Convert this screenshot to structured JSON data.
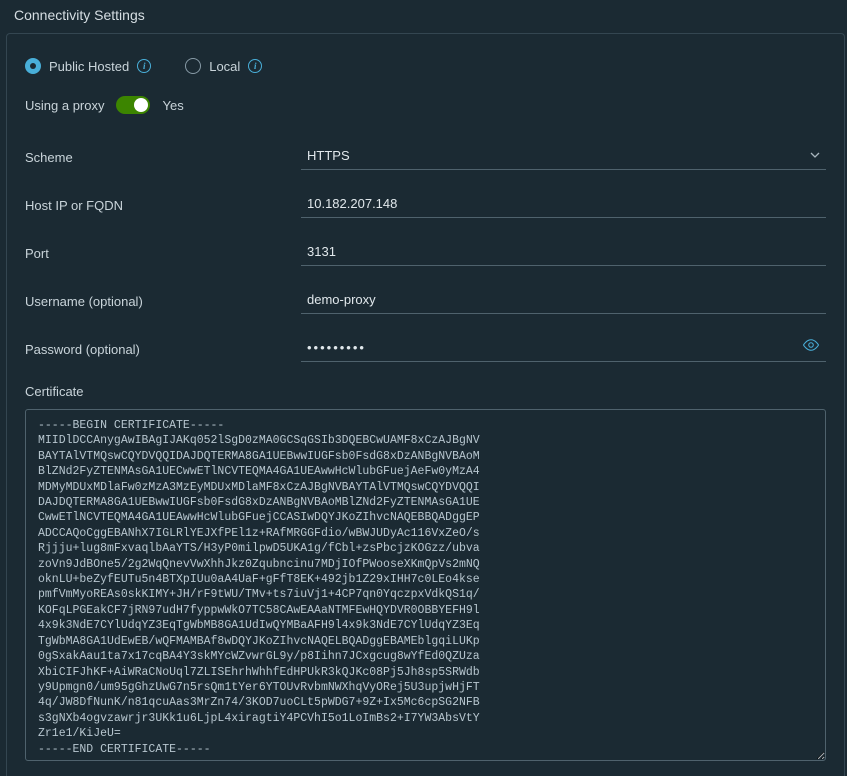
{
  "header": {
    "title": "Connectivity Settings"
  },
  "connection": {
    "options": {
      "public": {
        "label": "Public Hosted",
        "selected": true
      },
      "local": {
        "label": "Local",
        "selected": false
      }
    }
  },
  "proxy": {
    "label": "Using a proxy",
    "state_label": "Yes",
    "enabled": true
  },
  "fields": {
    "scheme": {
      "label": "Scheme",
      "value": "HTTPS"
    },
    "host": {
      "label": "Host IP or FQDN",
      "value": "10.182.207.148"
    },
    "port": {
      "label": "Port",
      "value": "3131"
    },
    "username": {
      "label": "Username (optional)",
      "value": "demo-proxy"
    },
    "password": {
      "label": "Password (optional)",
      "masked": "•••••••••"
    }
  },
  "certificate": {
    "label": "Certificate",
    "value": "-----BEGIN CERTIFICATE-----\nMIIDlDCCAnygAwIBAgIJAKq052lSgD0zMA0GCSqGSIb3DQEBCwUAMF8xCzAJBgNV\nBAYTAlVTMQswCQYDVQQIDAJDQTERMA8GA1UEBwwIUGFsb0FsdG8xDzANBgNVBAoM\nBlZNd2FyZTENMAsGA1UECwwETlNCVTEQMA4GA1UEAwwHcWlubGFuejAeFw0yMzA4\nMDMyMDUxMDlaFw0zMzA3MzEyMDUxMDlaMF8xCzAJBgNVBAYTAlVTMQswCQYDVQQI\nDAJDQTERMA8GA1UEBwwIUGFsb0FsdG8xDzANBgNVBAoMBlZNd2FyZTENMAsGA1UE\nCwwETlNCVTEQMA4GA1UEAwwHcWlubGFuejCCASIwDQYJKoZIhvcNAQEBBQADggEP\nADCCAQoCggEBANhX7IGLRlYEJXfPEl1z+RAfMRGGFdio/wBWJUDyAc116VxZeO/s\nRjjju+lug8mFxvaqlbAaYTS/H3yP0milpwD5UKA1g/fCbl+zsPbcjzKOGzz/ubva\nzoVn9JdBOne5/2g2WqQnevVwXhhJkz0Zqubncinu7MDjIOfPWooseXKmQpVs2mNQ\noknLU+beZyfEUTu5n4BTXpIUu0aA4UaF+gFfT8EK+492jb1Z29xIHH7c0LEo4kse\npmfVmMyoREAs0skKIMY+JH/rF9tWU/TMv+ts7iuVj1+4CP7qn0YqczpxVdkQS1q/\nKOFqLPGEakCF7jRN97udH7fyppwWkO7TC58CAwEAAaNTMFEwHQYDVR0OBBYEFH9l\n4x9k3NdE7CYlUdqYZ3EqTgWbMB8GA1UdIwQYMBaAFH9l4x9k3NdE7CYlUdqYZ3Eq\nTgWbMA8GA1UdEwEB/wQFMAMBAf8wDQYJKoZIhvcNAQELBQADggEBAMEblgqiLUKp\n0gSxakAau1ta7x17cqBA4Y3skMYcWZvwrGL9y/p8Iihn7JCxgcug8wYfEd0QZUza\nXbiCIFJhKF+AiWRaCNoUql7ZLISEhrhWhhfEdHPUkR3kQJKc08Pj5Jh8sp5SRWdb\ny9Upmgn0/um95gGhzUwG7n5rsQm1tYer6YTOUvRvbmNWXhqVyORej5U3upjwHjFT\n4q/JW8DfNunK/n81qcuAas3MrZn74/3KOD7uoCLt5pWDG7+9Z+Ix5Mc6cpSG2NFB\ns3gNXb4ogvzawrjr3UKk1u6LjpL4xiragtiY4PCVhI5o1LoImBs2+I7YW3AbsVtY\nZr1e1/KiJeU=\n-----END CERTIFICATE-----"
  }
}
